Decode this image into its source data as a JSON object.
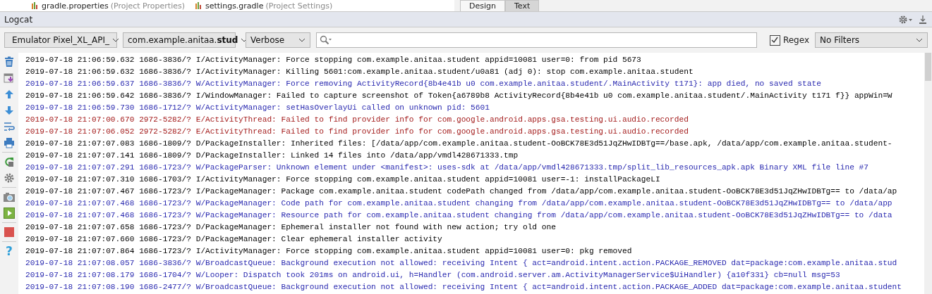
{
  "project_tree": {
    "items": [
      {
        "name": "gradle.properties",
        "note": "(Project Properties)"
      },
      {
        "name": "settings.gradle",
        "note": "(Project Settings)"
      }
    ]
  },
  "editor_tabs": [
    {
      "label": "Design",
      "selected": true
    },
    {
      "label": "Text",
      "selected": false
    }
  ],
  "panel": {
    "title": "Logcat"
  },
  "toolbar": {
    "device": "Emulator Pixel_XL_API_",
    "process": "com.example.anitaa.**stud**",
    "log_level": "Verbose",
    "regex": {
      "label": "Regex",
      "checked": true
    },
    "filter": "No Filters"
  },
  "side_toolbar": {
    "help_glyph": "?"
  },
  "log": [
    {
      "kind": "info",
      "text": "2019-07-18 21:06:59.632 1686-3836/? I/ActivityManager: Force stopping com.example.anitaa.student appid=10081 user=0: from pid 5673"
    },
    {
      "kind": "info",
      "text": "2019-07-18 21:06:59.632 1686-3836/? I/ActivityManager: Killing 5601:com.example.anitaa.student/u0a81 (adj 0): stop com.example.anitaa.student"
    },
    {
      "kind": "warning",
      "text": "2019-07-18 21:06:59.637 1686-3836/? W/ActivityManager: Force removing ActivityRecord{8b4e41b u0 com.example.anitaa.student/.MainActivity t171}: app died, no saved state"
    },
    {
      "kind": "info",
      "text": "2019-07-18 21:06:59.642 1686-3836/? I/WindowManager: Failed to capture screenshot of Token{a6789b8 ActivityRecord{8b4e41b u0 com.example.anitaa.student/.MainActivity t171 f}} appWin=W"
    },
    {
      "kind": "warning",
      "text": "2019-07-18 21:06:59.730 1686-1712/? W/ActivityManager: setHasOverlayUi called on unknown pid: 5601"
    },
    {
      "kind": "error",
      "text": "2019-07-18 21:07:00.670 2972-5282/? E/ActivityThread: Failed to find provider info for com.google.android.apps.gsa.testing.ui.audio.recorded"
    },
    {
      "kind": "error",
      "text": "2019-07-18 21:07:06.052 2972-5282/? E/ActivityThread: Failed to find provider info for com.google.android.apps.gsa.testing.ui.audio.recorded"
    },
    {
      "kind": "debug",
      "text": "2019-07-18 21:07:07.083 1686-1809/? D/PackageInstaller: Inherited files: [/data/app/com.example.anitaa.student-OoBCK78E3d51JqZHwIDBTg==/base.apk, /data/app/com.example.anitaa.student-"
    },
    {
      "kind": "debug",
      "text": "2019-07-18 21:07:07.141 1686-1809/? D/PackageInstaller: Linked 14 files into /data/app/vmdl428671333.tmp"
    },
    {
      "kind": "warning",
      "text": "2019-07-18 21:07:07.291 1686-1723/? W/PackageParser: Unknown element under <manifest>: uses-sdk at /data/app/vmdl428671333.tmp/split_lib_resources_apk.apk Binary XML file line #7"
    },
    {
      "kind": "info",
      "text": "2019-07-18 21:07:07.310 1686-1703/? I/ActivityManager: Force stopping com.example.anitaa.student appid=10081 user=-1: installPackageLI"
    },
    {
      "kind": "info",
      "text": "2019-07-18 21:07:07.467 1686-1723/? I/PackageManager: Package com.example.anitaa.student codePath changed from /data/app/com.example.anitaa.student-OoBCK78E3d51JqZHwIDBTg== to /data/ap"
    },
    {
      "kind": "warning",
      "text": "2019-07-18 21:07:07.468 1686-1723/? W/PackageManager: Code path for com.example.anitaa.student changing from /data/app/com.example.anitaa.student-OoBCK78E3d51JqZHwIDBTg== to /data/app"
    },
    {
      "kind": "warning",
      "text": "2019-07-18 21:07:07.468 1686-1723/? W/PackageManager: Resource path for com.example.anitaa.student changing from /data/app/com.example.anitaa.student-OoBCK78E3d51JqZHwIDBTg== to /data"
    },
    {
      "kind": "debug",
      "text": "2019-07-18 21:07:07.658 1686-1723/? D/PackageManager: Ephemeral installer not found with new action; try old one"
    },
    {
      "kind": "debug",
      "text": "2019-07-18 21:07:07.660 1686-1723/? D/PackageManager: Clear ephemeral installer activity"
    },
    {
      "kind": "info",
      "text": "2019-07-18 21:07:07.864 1686-1723/? I/ActivityManager: Force stopping com.example.anitaa.student appid=10081 user=0: pkg removed"
    },
    {
      "kind": "warning",
      "text": "2019-07-18 21:07:08.057 1686-3836/? W/BroadcastQueue: Background execution not allowed: receiving Intent { act=android.intent.action.PACKAGE_REMOVED dat=package:com.example.anitaa.stud"
    },
    {
      "kind": "warning",
      "text": "2019-07-18 21:07:08.179 1686-1704/? W/Looper: Dispatch took 201ms on android.ui, h=Handler (com.android.server.am.ActivityManagerService$UiHandler) {a10f331} cb=null msg=53"
    },
    {
      "kind": "warning",
      "text": "2019-07-18 21:07:08.190 1686-2477/? W/BroadcastQueue: Background execution not allowed: receiving Intent { act=android.intent.action.PACKAGE_ADDED dat=package:com.example.anitaa.student"
    }
  ]
}
